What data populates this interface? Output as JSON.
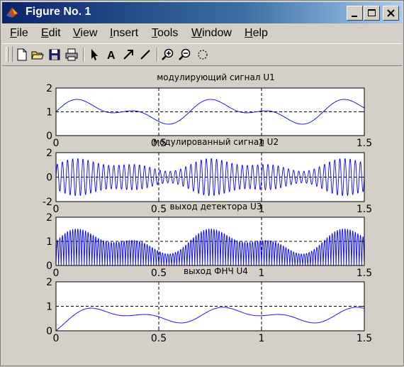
{
  "window": {
    "title": "Figure No. 1"
  },
  "menu": [
    "File",
    "Edit",
    "View",
    "Insert",
    "Tools",
    "Window",
    "Help"
  ],
  "toolbar": [
    "new-figure",
    "open-file",
    "save",
    "print",
    "select-arrow",
    "insert-text",
    "insert-arrow",
    "insert-line",
    "zoom-in",
    "zoom-out",
    "rotate-3d"
  ],
  "colors": {
    "titlebar": "#0a246a",
    "signal": "#0000ff",
    "background": "#d4d0c8"
  },
  "chart_data": [
    {
      "type": "line",
      "title": "модулирующий сигнал U1",
      "xlim": [
        0,
        1.5
      ],
      "ylim": [
        0,
        2
      ],
      "xticks": [
        "0",
        "0.5",
        "1",
        "1.5"
      ],
      "yticks": [
        "0",
        "1",
        "2"
      ],
      "grid": true
    },
    {
      "type": "line",
      "title": "модулированный сигнал U2",
      "xlim": [
        0,
        1.5
      ],
      "ylim": [
        -2,
        2
      ],
      "xticks": [
        "0",
        "0.5",
        "1",
        "1.5"
      ],
      "yticks": [
        "-2",
        "0",
        "2"
      ],
      "grid": true
    },
    {
      "type": "line",
      "title": "выход детектора U3",
      "xlim": [
        0,
        1.5
      ],
      "ylim": [
        0,
        2
      ],
      "xticks": [
        "0",
        "0.5",
        "1",
        "1.5"
      ],
      "yticks": [
        "0",
        "1",
        "2"
      ],
      "grid": true
    },
    {
      "type": "line",
      "title": "выход ФНЧ U4",
      "xlim": [
        0,
        1.5
      ],
      "ylim": [
        0,
        2
      ],
      "xticks": [
        "0",
        "0.5",
        "1",
        "1.5"
      ],
      "yticks": [
        "0",
        "1",
        "2"
      ],
      "grid": true
    }
  ]
}
